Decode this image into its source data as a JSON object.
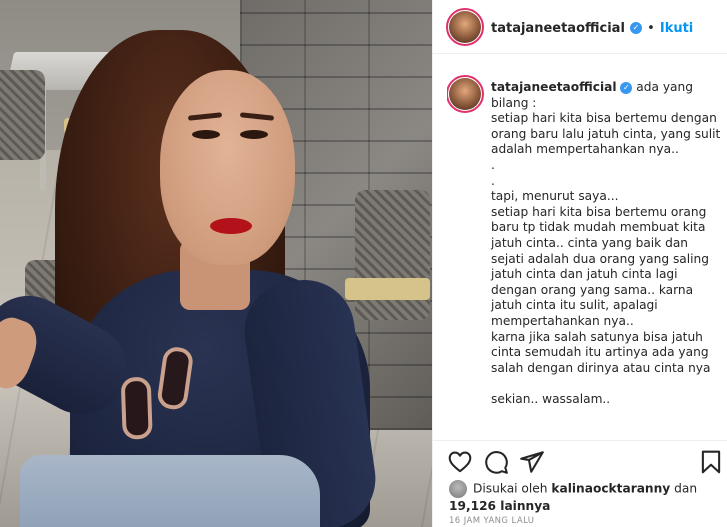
{
  "post": {
    "username": "tatajaneetaofficial",
    "follow_label": "Ikuti",
    "separator": "•",
    "caption": "ada yang bilang :\nsetiap hari kita bisa bertemu dengan orang baru lalu jatuh cinta, yang sulit adalah mempertahankan nya..\n.\n.\ntapi, menurut saya...\nsetiap hari kita bisa bertemu orang baru tp tidak mudah membuat kita jatuh cinta.. cinta yang baik dan sejati adalah dua orang yang saling jatuh cinta dan jatuh cinta lagi dengan orang yang sama.. karna jatuh cinta itu sulit, apalagi mempertahankan nya..\nkarna jika salah satunya bisa jatuh cinta semudah itu artinya ada yang salah dengan dirinya atau cinta nya\n\nsekian.. wassalam..",
    "likes_prefix": "Disukai oleh ",
    "liked_by_user": "kalinaocktaranny",
    "likes_middle": " dan ",
    "likes_count": "19,126 lainnya",
    "timestamp": "16 JAM YANG LALU"
  },
  "icons": {
    "verified": "verified-badge-icon",
    "like": "heart-icon",
    "comment": "comment-icon",
    "share": "share-icon",
    "save": "bookmark-icon"
  },
  "colors": {
    "accent": "#0095f6",
    "verified": "#3897f0",
    "text": "#262626",
    "muted": "#8e8e8e"
  }
}
